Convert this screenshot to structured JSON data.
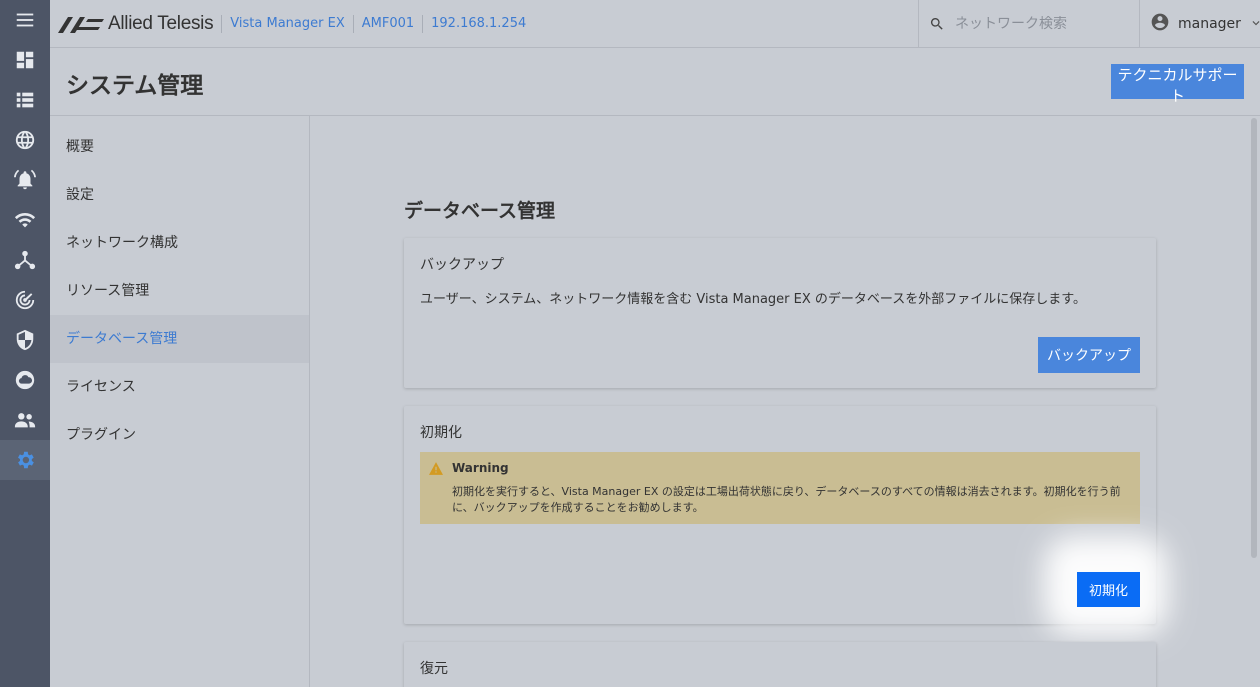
{
  "rail": {
    "items": [
      {
        "name": "menu-icon",
        "active": false
      },
      {
        "name": "dashboard-icon",
        "active": false
      },
      {
        "name": "list-icon",
        "active": false
      },
      {
        "name": "globe-icon",
        "active": false
      },
      {
        "name": "alarm-icon",
        "active": false
      },
      {
        "name": "wifi-icon",
        "active": false
      },
      {
        "name": "topology-icon",
        "active": false
      },
      {
        "name": "radar-icon",
        "active": false
      },
      {
        "name": "shield-icon",
        "active": false
      },
      {
        "name": "cloud-icon",
        "active": false
      },
      {
        "name": "people-icon",
        "active": false
      },
      {
        "name": "gear-icon",
        "active": true
      }
    ]
  },
  "header": {
    "logo_text": "Allied Telesis",
    "breadcrumbs": [
      "Vista Manager EX",
      "AMF001",
      "192.168.1.254"
    ],
    "search_placeholder": "ネットワーク検索",
    "username": "manager"
  },
  "page": {
    "title": "システム管理",
    "tech_support_label": "テクニカルサポート"
  },
  "subnav": {
    "items": [
      "概要",
      "設定",
      "ネットワーク構成",
      "リソース管理",
      "データベース管理",
      "ライセンス",
      "プラグイン"
    ],
    "active_index": 4
  },
  "main": {
    "section_title": "データベース管理",
    "backup": {
      "title": "バックアップ",
      "description": "ユーザー、システム、ネットワーク情報を含む Vista Manager EX のデータベースを外部ファイルに保存します。",
      "button_label": "バックアップ"
    },
    "init": {
      "title": "初期化",
      "warning_title": "Warning",
      "warning_body": "初期化を実行すると、Vista Manager EX の設定は工場出荷状態に戻り、データベースのすべての情報は消去されます。初期化を行う前に、バックアップを作成することをお勧めします。",
      "button_label": "初期化"
    },
    "restore": {
      "title": "復元"
    }
  },
  "colors": {
    "accent": "#4a86dc",
    "primary_button": "#0a6cf5",
    "warning_bg": "#c9bd93",
    "rail_bg": "#4d5566"
  }
}
